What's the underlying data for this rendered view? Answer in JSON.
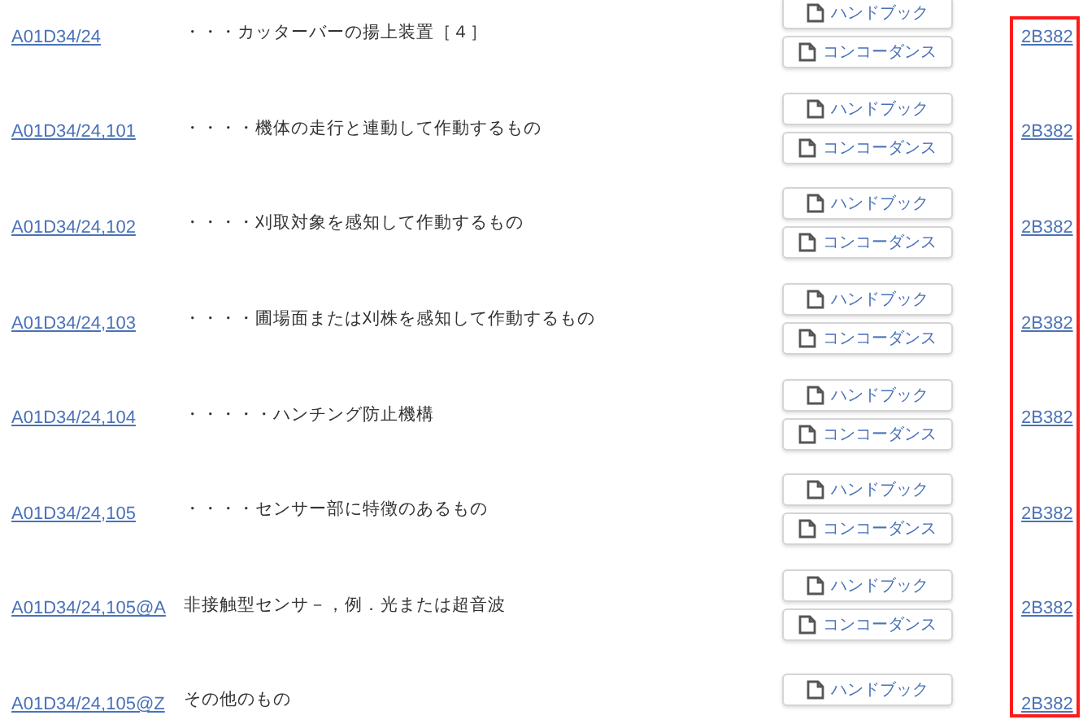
{
  "class_column_highlighted": true,
  "rows": [
    {
      "code": "A01D34/24",
      "description": "・・・カッターバーの揚上装置［４］",
      "buttons": [
        "ハンドブック",
        "コンコーダンス"
      ],
      "theme": "2B382"
    },
    {
      "code": "A01D34/24,101",
      "description": "・・・・機体の走行と連動して作動するもの",
      "buttons": [
        "ハンドブック",
        "コンコーダンス"
      ],
      "theme": "2B382"
    },
    {
      "code": "A01D34/24,102",
      "description": "・・・・刈取対象を感知して作動するもの",
      "buttons": [
        "ハンドブック",
        "コンコーダンス"
      ],
      "theme": "2B382"
    },
    {
      "code": "A01D34/24,103",
      "description": "・・・・圃場面または刈株を感知して作動するもの",
      "buttons": [
        "ハンドブック",
        "コンコーダンス"
      ],
      "theme": "2B382"
    },
    {
      "code": "A01D34/24,104",
      "description": "・・・・・ハンチング防止機構",
      "buttons": [
        "ハンドブック",
        "コンコーダンス"
      ],
      "theme": "2B382"
    },
    {
      "code": "A01D34/24,105",
      "description": "・・・・センサー部に特徴のあるもの",
      "buttons": [
        "ハンドブック",
        "コンコーダンス"
      ],
      "theme": "2B382"
    },
    {
      "code": "A01D34/24,105@A",
      "description": "非接触型センサ－，例．光または超音波",
      "buttons": [
        "ハンドブック",
        "コンコーダンス"
      ],
      "theme": "2B382"
    },
    {
      "code": "A01D34/24,105@Z",
      "description": "その他のもの",
      "buttons": [
        "ハンドブック"
      ],
      "theme": "2B382"
    }
  ]
}
